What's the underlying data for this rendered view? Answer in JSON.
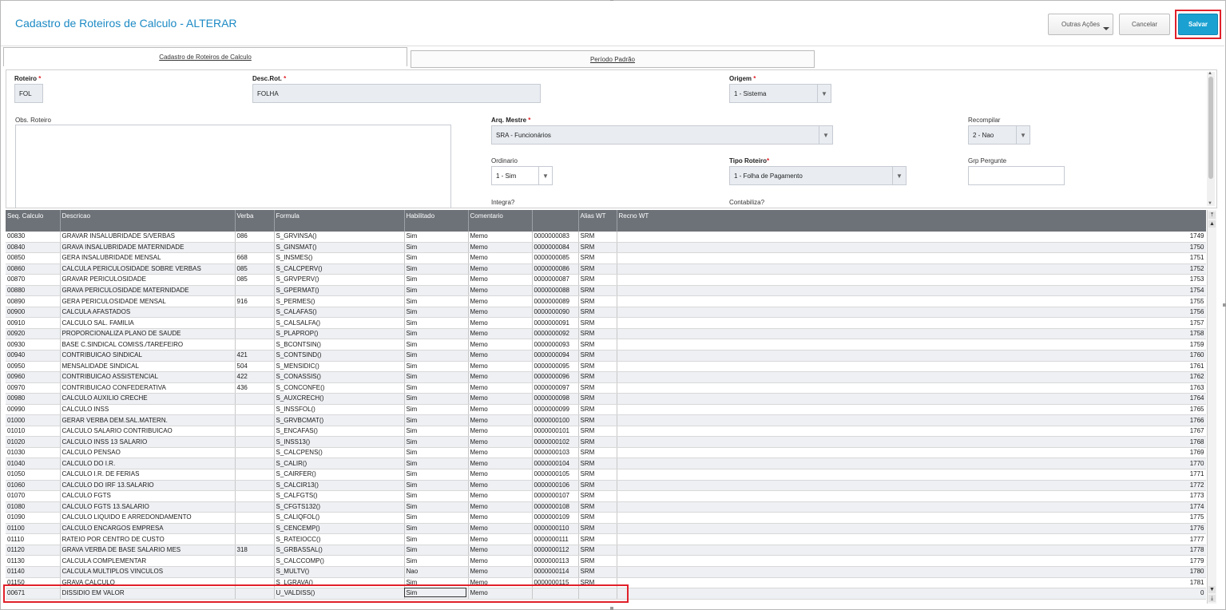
{
  "header": {
    "title": "Cadastro de Roteiros de Calculo - ALTERAR",
    "buttons": {
      "outras": "Outras Ações",
      "cancelar": "Cancelar",
      "salvar": "Salvar"
    }
  },
  "tabs": [
    {
      "label": "Cadastro de Roteiros de Calculo"
    },
    {
      "label": "Período Padrão"
    }
  ],
  "form": {
    "roteiro": {
      "label": "Roteiro",
      "value": "FOL"
    },
    "desc_rot": {
      "label": "Desc.Rot.",
      "value": "FOLHA"
    },
    "origem": {
      "label": "Origem",
      "value": "1 - Sistema"
    },
    "obs_roteiro": {
      "label": "Obs. Roteiro"
    },
    "arq_mestre": {
      "label": "Arq. Mestre",
      "value": "SRA - Funcionários"
    },
    "recompilar": {
      "label": "Recompilar",
      "value": "2 - Nao"
    },
    "ordinario": {
      "label": "Ordinario",
      "value": "1 - Sim"
    },
    "tipo_roteiro": {
      "label": "Tipo Roteiro",
      "value": "1 - Folha de Pagamento"
    },
    "grp_pergunte": {
      "label": "Grp Pergunte",
      "value": ""
    },
    "integra": {
      "label": "Integra?"
    },
    "contabiliza": {
      "label": "Contabiliza?"
    }
  },
  "grid": {
    "columns": [
      "Seq. Calculo",
      "Descricao",
      "Verba",
      "Formula",
      "Habilitado",
      "Comentario",
      "",
      "Alias WT",
      "Recno WT"
    ],
    "rows": [
      [
        "00830",
        "GRAVAR INSALUBRIDADE S/VERBAS",
        "086",
        "S_GRVINSA()",
        "Sim",
        "Memo",
        "0000000083",
        "SRM",
        "1749"
      ],
      [
        "00840",
        "GRAVA INSALUBRIDADE MATERNIDADE",
        "",
        "S_GINSMAT()",
        "Sim",
        "Memo",
        "0000000084",
        "SRM",
        "1750"
      ],
      [
        "00850",
        "GERA INSALUBRIDADE MENSAL",
        "668",
        "S_INSMES()",
        "Sim",
        "Memo",
        "0000000085",
        "SRM",
        "1751"
      ],
      [
        "00860",
        "CALCULA PERICULOSIDADE SOBRE VERBAS",
        "085",
        "S_CALCPERV()",
        "Sim",
        "Memo",
        "0000000086",
        "SRM",
        "1752"
      ],
      [
        "00870",
        "GRAVAR PERICULOSIDADE",
        "085",
        "S_GRVPERV()",
        "Sim",
        "Memo",
        "0000000087",
        "SRM",
        "1753"
      ],
      [
        "00880",
        "GRAVA PERICULOSIDADE MATERNIDADE",
        "",
        "S_GPERMAT()",
        "Sim",
        "Memo",
        "0000000088",
        "SRM",
        "1754"
      ],
      [
        "00890",
        "GERA PERICULOSIDADE MENSAL",
        "916",
        "S_PERMES()",
        "Sim",
        "Memo",
        "0000000089",
        "SRM",
        "1755"
      ],
      [
        "00900",
        "CALCULA AFASTADOS",
        "",
        "S_CALAFAS()",
        "Sim",
        "Memo",
        "0000000090",
        "SRM",
        "1756"
      ],
      [
        "00910",
        "CALCULO SAL. FAMILIA",
        "",
        "S_CALSALFA()",
        "Sim",
        "Memo",
        "0000000091",
        "SRM",
        "1757"
      ],
      [
        "00920",
        "PROPORCIONALIZA PLANO DE SAUDE",
        "",
        "S_PLAPROP()",
        "Sim",
        "Memo",
        "0000000092",
        "SRM",
        "1758"
      ],
      [
        "00930",
        "BASE C.SINDICAL COMISS./TAREFEIRO",
        "",
        "S_BCONTSIN()",
        "Sim",
        "Memo",
        "0000000093",
        "SRM",
        "1759"
      ],
      [
        "00940",
        "CONTRIBUICAO SINDICAL",
        "421",
        "S_CONTSIND()",
        "Sim",
        "Memo",
        "0000000094",
        "SRM",
        "1760"
      ],
      [
        "00950",
        "MENSALIDADE SINDICAL",
        "504",
        "S_MENSIDIC()",
        "Sim",
        "Memo",
        "0000000095",
        "SRM",
        "1761"
      ],
      [
        "00960",
        "CONTRIBUICAO ASSISTENCIAL",
        "422",
        "S_CONASSIS()",
        "Sim",
        "Memo",
        "0000000096",
        "SRM",
        "1762"
      ],
      [
        "00970",
        "CONTRIBUICAO CONFEDERATIVA",
        "436",
        "S_CONCONFE()",
        "Sim",
        "Memo",
        "0000000097",
        "SRM",
        "1763"
      ],
      [
        "00980",
        "CALCULO AUXILIO CRECHE",
        "",
        "S_AUXCRECH()",
        "Sim",
        "Memo",
        "0000000098",
        "SRM",
        "1764"
      ],
      [
        "00990",
        "CALCULO INSS",
        "",
        "S_INSSFOL()",
        "Sim",
        "Memo",
        "0000000099",
        "SRM",
        "1765"
      ],
      [
        "01000",
        "GERAR VERBA DEM.SAL.MATERN.",
        "",
        "S_GRVBCMAT()",
        "Sim",
        "Memo",
        "0000000100",
        "SRM",
        "1766"
      ],
      [
        "01010",
        "CALCULO SALARIO CONTRIBUICAO",
        "",
        "S_ENCAFAS()",
        "Sim",
        "Memo",
        "0000000101",
        "SRM",
        "1767"
      ],
      [
        "01020",
        "CALCULO INSS 13 SALARIO",
        "",
        "S_INSS13()",
        "Sim",
        "Memo",
        "0000000102",
        "SRM",
        "1768"
      ],
      [
        "01030",
        "CALCULO PENSAO",
        "",
        "S_CALCPENS()",
        "Sim",
        "Memo",
        "0000000103",
        "SRM",
        "1769"
      ],
      [
        "01040",
        "CALCULO DO I.R.",
        "",
        "S_CALIR()",
        "Sim",
        "Memo",
        "0000000104",
        "SRM",
        "1770"
      ],
      [
        "01050",
        "CALCULO I.R. DE FERIAS",
        "",
        "S_CAIRFER()",
        "Sim",
        "Memo",
        "0000000105",
        "SRM",
        "1771"
      ],
      [
        "01060",
        "CALCULO DO IRF 13.SALARIO",
        "",
        "S_CALCIR13()",
        "Sim",
        "Memo",
        "0000000106",
        "SRM",
        "1772"
      ],
      [
        "01070",
        "CALCULO FGTS",
        "",
        "S_CALFGTS()",
        "Sim",
        "Memo",
        "0000000107",
        "SRM",
        "1773"
      ],
      [
        "01080",
        "CALCULO FGTS 13.SALARIO",
        "",
        "S_CFGTS132()",
        "Sim",
        "Memo",
        "0000000108",
        "SRM",
        "1774"
      ],
      [
        "01090",
        "CALCULO LIQUIDO E ARREDONDAMENTO",
        "",
        "S_CALIQFOL()",
        "Sim",
        "Memo",
        "0000000109",
        "SRM",
        "1775"
      ],
      [
        "01100",
        "CALCULO ENCARGOS EMPRESA",
        "",
        "S_CENCEMP()",
        "Sim",
        "Memo",
        "0000000110",
        "SRM",
        "1776"
      ],
      [
        "01110",
        "RATEIO POR CENTRO DE CUSTO",
        "",
        "S_RATEIOCC()",
        "Sim",
        "Memo",
        "0000000111",
        "SRM",
        "1777"
      ],
      [
        "01120",
        "GRAVA VERBA DE BASE SALARIO MES",
        "318",
        "S_GRBASSAL()",
        "Sim",
        "Memo",
        "0000000112",
        "SRM",
        "1778"
      ],
      [
        "01130",
        "CALCULA COMPLEMENTAR",
        "",
        "S_CALCCOMP()",
        "Sim",
        "Memo",
        "0000000113",
        "SRM",
        "1779"
      ],
      [
        "01140",
        "CALCULA MULTIPLOS VINCULOS",
        "",
        "S_MULTV()",
        "Nao",
        "Memo",
        "0000000114",
        "SRM",
        "1780"
      ],
      [
        "01150",
        "GRAVA CALCULO",
        "",
        "S_LGRAVA()",
        "Sim",
        "Memo",
        "0000000115",
        "SRM",
        "1781"
      ],
      [
        "00671",
        "DISSIDIO EM VALOR",
        "",
        "U_VALDISS()",
        "Sim",
        "Memo",
        "",
        "",
        "0"
      ]
    ]
  }
}
